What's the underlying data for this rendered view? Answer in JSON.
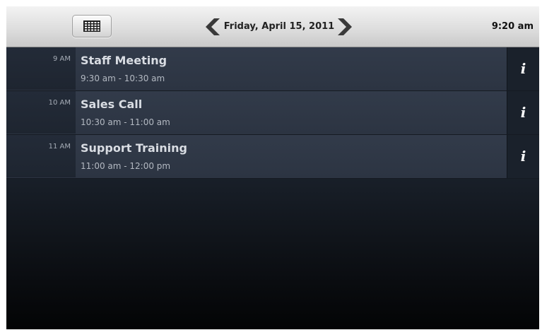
{
  "toolbar": {
    "list_view_icon": "list-view-icon",
    "grid_view_icon": "grid-view-icon",
    "prev_icon": "chevron-left-icon",
    "next_icon": "chevron-right-icon",
    "date": "Friday, April 15, 2011",
    "clock": "9:20 am"
  },
  "events": [
    {
      "hour": "9 AM",
      "title": "Staff Meeting",
      "time": "9:30 am - 10:30 am",
      "info": "i"
    },
    {
      "hour": "10 AM",
      "title": "Sales Call",
      "time": "10:30 am - 11:00 am",
      "info": "i"
    },
    {
      "hour": "11 AM",
      "title": "Support Training",
      "time": "11:00 am - 12:00 pm",
      "info": "i"
    }
  ]
}
